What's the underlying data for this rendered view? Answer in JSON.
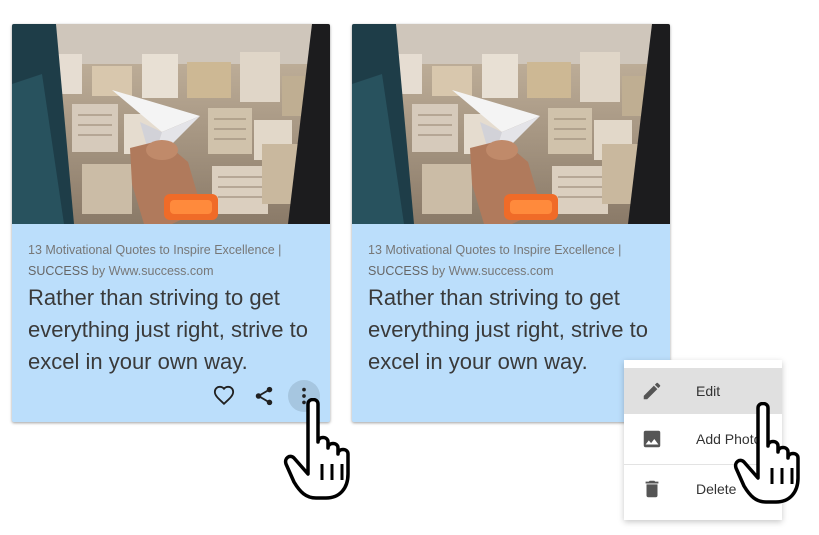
{
  "cards": [
    {
      "source_title": "13 Motivational Quotes to Inspire Excellence |",
      "source_name": "SUCCESS",
      "source_by": "by",
      "source_site": "Www.success.com",
      "quote": "Rather than striving to get everything just right, strive to excel in your own way.",
      "actions": [
        "heart-icon",
        "share-icon",
        "more-vert-icon"
      ]
    },
    {
      "source_title": "13 Motivational Quotes to Inspire Excellence |",
      "source_name": "SUCCESS",
      "source_by": "by",
      "source_site": "Www.success.com",
      "quote": "Rather than striving to get everything just right, strive to excel in your own way."
    }
  ],
  "menu": {
    "items": [
      {
        "label": "Edit",
        "icon": "pencil-icon",
        "highlighted": true
      },
      {
        "label": "Add Photo",
        "icon": "image-icon"
      },
      {
        "label": "Delete",
        "icon": "trash-icon"
      }
    ]
  },
  "colors": {
    "card_background": "#bbdefb",
    "menu_highlight": "#e0e0e0",
    "icon_color": "#212121"
  }
}
